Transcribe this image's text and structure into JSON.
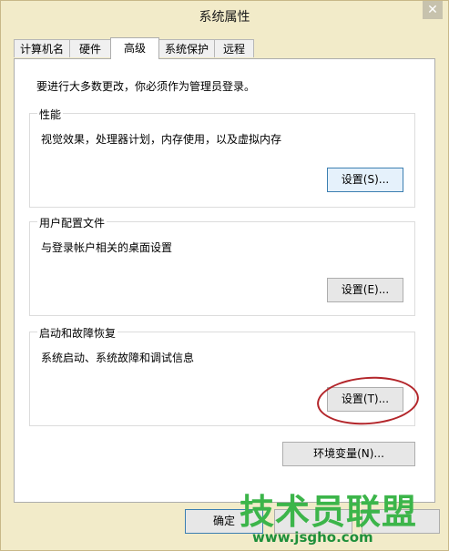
{
  "window": {
    "title": "系统属性",
    "close_glyph": "✕"
  },
  "tabs": [
    {
      "label": "计算机名",
      "active": false
    },
    {
      "label": "硬件",
      "active": false
    },
    {
      "label": "高级",
      "active": true
    },
    {
      "label": "系统保护",
      "active": false
    },
    {
      "label": "远程",
      "active": false
    }
  ],
  "advanced": {
    "intro": "要进行大多数更改，你必须作为管理员登录。",
    "performance": {
      "label": "性能",
      "description": "视觉效果，处理器计划，内存使用，以及虚拟内存",
      "button": "设置(S)..."
    },
    "user_profiles": {
      "label": "用户配置文件",
      "description": "与登录帐户相关的桌面设置",
      "button": "设置(E)..."
    },
    "startup_recovery": {
      "label": "启动和故障恢复",
      "description": "系统启动、系统故障和调试信息",
      "button": "设置(T)..."
    },
    "env_button": "环境变量(N)..."
  },
  "footer": {
    "ok_label": "确定"
  },
  "watermark": {
    "brand": "技术员联盟",
    "url": "www.jsgho.com"
  },
  "colors": {
    "annotation": "#b3262b",
    "watermark": "#3cb54a"
  }
}
